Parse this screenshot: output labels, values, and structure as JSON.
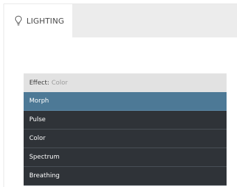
{
  "tab": {
    "label": "LIGHTING",
    "icon": "lightbulb-icon"
  },
  "effect": {
    "label": "Effect:",
    "value": "Color",
    "options": [
      {
        "label": "Morph",
        "selected": true
      },
      {
        "label": "Pulse",
        "selected": false
      },
      {
        "label": "Color",
        "selected": false
      },
      {
        "label": "Spectrum",
        "selected": false
      },
      {
        "label": "Breathing",
        "selected": false
      }
    ]
  },
  "colors": {
    "tab_strip": "#ececec",
    "header_bg": "#e2e2e2",
    "option_bg": "#2f3338",
    "selected_bg": "#4d7996"
  }
}
